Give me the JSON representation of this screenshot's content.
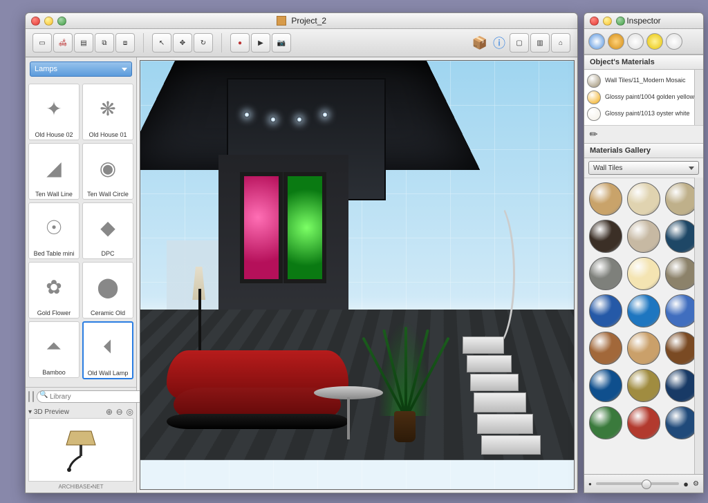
{
  "main": {
    "title": "Project_2",
    "sidebar": {
      "category": "Lamps",
      "items": [
        {
          "label": "Old House 02",
          "glyph": "✦"
        },
        {
          "label": "Old House 01",
          "glyph": "❋"
        },
        {
          "label": "Ten Wall Line",
          "glyph": "◢"
        },
        {
          "label": "Ten Wall Circle",
          "glyph": "◉"
        },
        {
          "label": "Bed Table mini",
          "glyph": "☉"
        },
        {
          "label": "DPC",
          "glyph": "◆"
        },
        {
          "label": "Gold Flower",
          "glyph": "✿"
        },
        {
          "label": "Ceramic Old",
          "glyph": "⬤"
        },
        {
          "label": "Bamboo",
          "glyph": "⏶"
        },
        {
          "label": "Old Wall Lamp",
          "glyph": "⏴",
          "selected": true
        }
      ],
      "search_placeholder": "Library",
      "preview_label": "3D Preview"
    }
  },
  "inspector": {
    "title": "Inspector",
    "materials_header": "Object's Materials",
    "materials": [
      {
        "name": "Wall Tiles/11_Modern Mosaic",
        "color": "#9a8c6e"
      },
      {
        "name": "Glossy paint/1004 golden yellow",
        "color": "#f2a90e"
      },
      {
        "name": "Glossy paint/1013 oyster white",
        "color": "#f3efe6"
      }
    ],
    "gallery_header": "Materials Gallery",
    "gallery_category": "Wall Tiles",
    "swatches": [
      "#c9a36a",
      "#e0d3b0",
      "#bfb08a",
      "#3b2f26",
      "#c7b9a3",
      "#1e4766",
      "#7e807b",
      "#f4e4b2",
      "#8c826a",
      "#2559a7",
      "#1e76c0",
      "#406ebf",
      "#a2683a",
      "#caa06a",
      "#7a4a23",
      "#0f4f8d",
      "#a08c40",
      "#183a66",
      "#3a7a3c",
      "#b23a2e",
      "#204a7a"
    ]
  }
}
